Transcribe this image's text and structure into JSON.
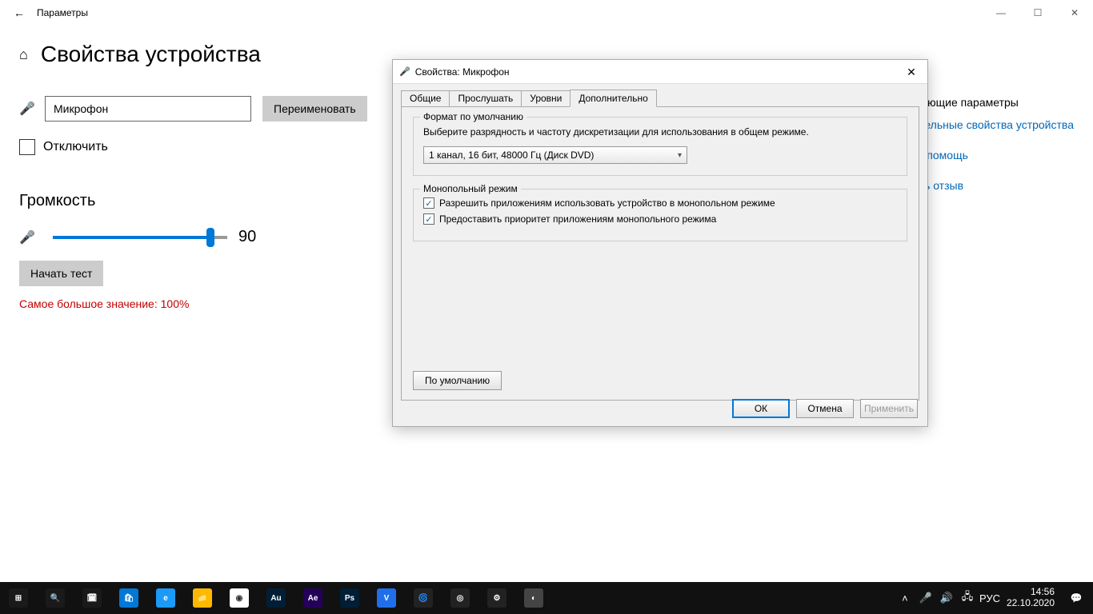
{
  "settings": {
    "window_title": "Параметры",
    "page_title": "Свойства устройства",
    "device_name": "Микрофон",
    "rename_label": "Переименовать",
    "disable_label": "Отключить",
    "volume_section": "Громкость",
    "volume_value": "90",
    "test_label": "Начать тест",
    "max_value_text": "Самое большое значение: 100%",
    "right": {
      "heading": "Сопутствующие параметры",
      "link1": "Дополнительные свойства устройства",
      "link2": "Получить помощь",
      "link3": "Отправить отзыв"
    }
  },
  "dialog": {
    "title": "Свойства: Микрофон",
    "tabs": [
      "Общие",
      "Прослушать",
      "Уровни",
      "Дополнительно"
    ],
    "active_tab": 3,
    "group1": {
      "legend": "Формат по умолчанию",
      "text": "Выберите разрядность и частоту дискретизации для использования в общем режиме.",
      "combo_value": "1 канал, 16 бит, 48000 Гц (Диск DVD)"
    },
    "group2": {
      "legend": "Монопольный режим",
      "check1": "Разрешить приложениям использовать устройство в монопольном режиме",
      "check2": "Предоставить приоритет приложениям монопольного режима"
    },
    "default_btn": "По умолчанию",
    "ok": "ОК",
    "cancel": "Отмена",
    "apply": "Применить"
  },
  "taskbar": {
    "apps": [
      {
        "bg": "#1a1a1a",
        "label": "⊞"
      },
      {
        "bg": "#1a1a1a",
        "label": "🔍"
      },
      {
        "bg": "#1a1a1a",
        "label": "🗓"
      },
      {
        "bg": "#0078d7",
        "label": "🛍"
      },
      {
        "bg": "#1b9af7",
        "label": "e"
      },
      {
        "bg": "#ffb900",
        "label": "📁"
      },
      {
        "bg": "#fff",
        "label": "◉"
      },
      {
        "bg": "#011e36",
        "label": "Au"
      },
      {
        "bg": "#24005a",
        "label": "Ae"
      },
      {
        "bg": "#001e36",
        "label": "Ps"
      },
      {
        "bg": "#1f6feb",
        "label": "V"
      },
      {
        "bg": "#222",
        "label": "🌀"
      },
      {
        "bg": "#222",
        "label": "◎"
      },
      {
        "bg": "#222",
        "label": "⚙"
      },
      {
        "bg": "#444",
        "label": "◐"
      }
    ],
    "tray": {
      "lang": "РУС",
      "time": "14:56",
      "date": "22.10.2020"
    }
  }
}
